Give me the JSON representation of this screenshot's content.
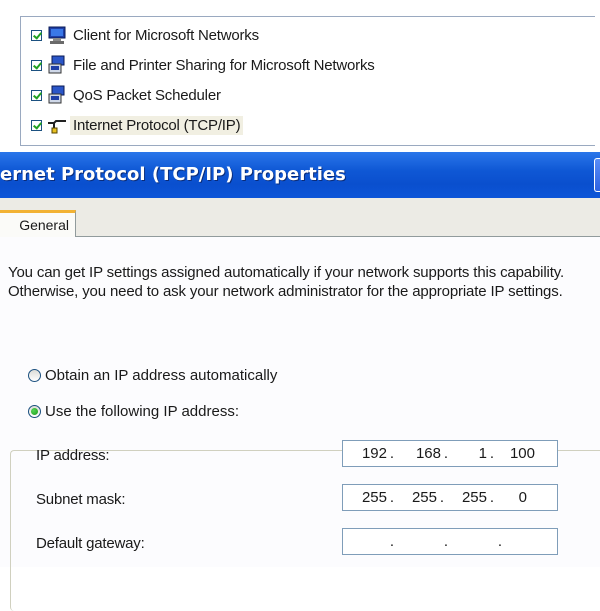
{
  "components": [
    {
      "label": "Client for Microsoft Networks",
      "checked": true,
      "icon": "network-client-icon"
    },
    {
      "label": "File and Printer Sharing for Microsoft Networks",
      "checked": true,
      "icon": "network-service-icon"
    },
    {
      "label": "QoS Packet Scheduler",
      "checked": true,
      "icon": "network-service-icon"
    },
    {
      "label": "Internet Protocol (TCP/IP)",
      "checked": true,
      "icon": "network-protocol-icon",
      "selected": true
    }
  ],
  "dialog": {
    "title": "ernet Protocol (TCP/IP) Properties",
    "tab_label": "General",
    "description": "You can get IP settings assigned automatically if your network supports this capability. Otherwise, you need to ask your network administrator for the appropriate IP settings.",
    "radio_auto": "Obtain an IP address automatically",
    "radio_manual": "Use the following IP address:",
    "selected_radio": "manual",
    "fields": {
      "ip_label": "IP address:",
      "ip_octets": [
        "192",
        "168",
        "1",
        "100"
      ],
      "subnet_label": "Subnet mask:",
      "subnet_octets": [
        "255",
        "255",
        "255",
        "0"
      ],
      "gateway_label": "Default gateway:",
      "gateway_octets": [
        "",
        "",
        "",
        ""
      ]
    }
  },
  "colors": {
    "title_bar": "#0a4fce",
    "tab_highlight": "#f2b233",
    "dialog_bg": "#fcfcfe",
    "radio_checked": "#21a121"
  }
}
